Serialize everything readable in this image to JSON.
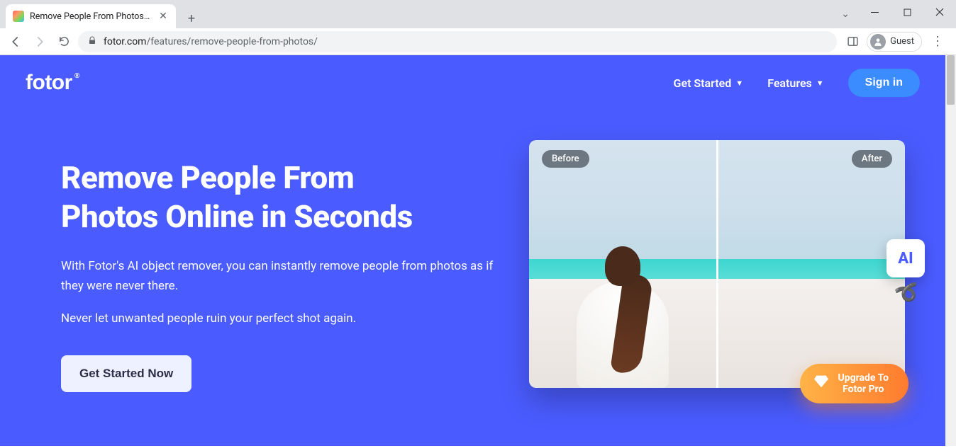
{
  "browser": {
    "tab_title": "Remove People From Photos O",
    "url_host": "fotor.com",
    "url_path": "/features/remove-people-from-photos/",
    "guest_label": "Guest"
  },
  "header": {
    "logo_text": "fotor",
    "nav": {
      "get_started": "Get Started",
      "features": "Features"
    },
    "signin": "Sign in"
  },
  "hero": {
    "title_line1": "Remove People From",
    "title_line2": "Photos Online in Seconds",
    "para1": "With Fotor's AI object remover, you can instantly remove people from photos as if they were never there.",
    "para2": "Never let unwanted people ruin your perfect shot again.",
    "cta": "Get Started Now",
    "before_label": "Before",
    "after_label": "After",
    "ai_badge": "AI"
  },
  "upgrade": {
    "line1": "Upgrade To",
    "line2": "Fotor Pro"
  }
}
